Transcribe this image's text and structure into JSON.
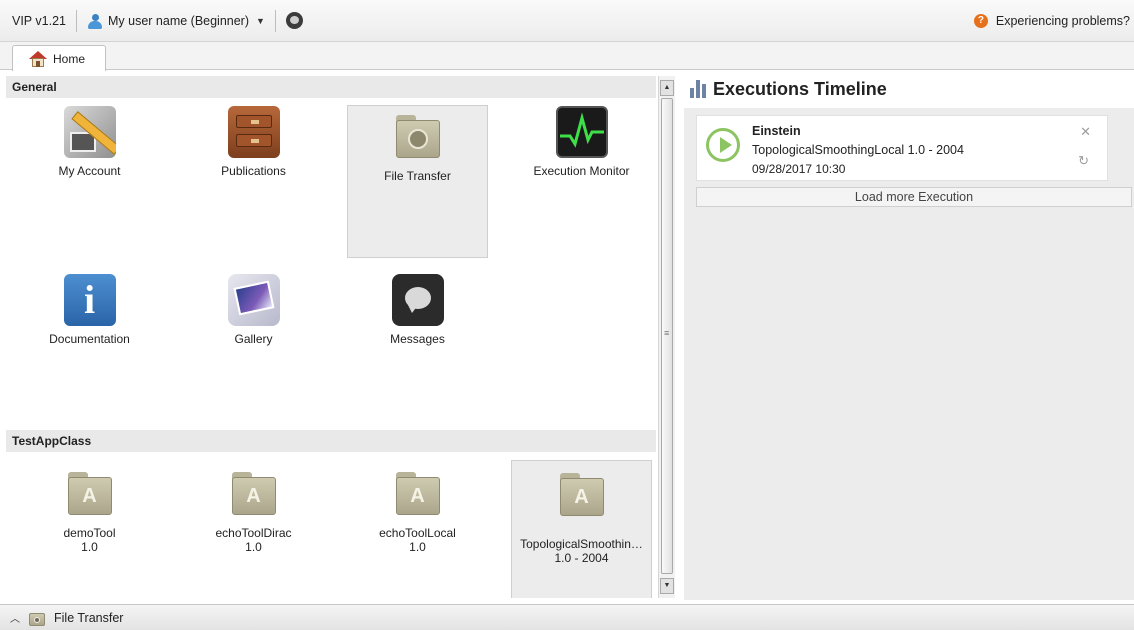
{
  "topbar": {
    "version": "VIP v1.21",
    "user_label": "My user name (Beginner)",
    "problems_label": "Experiencing problems?"
  },
  "tabs": [
    {
      "label": "Home",
      "icon": "home-icon",
      "active": true
    }
  ],
  "sections": [
    {
      "title": "General",
      "tiles": [
        {
          "label": "My Account",
          "icon": "my-account-icon"
        },
        {
          "label": "Publications",
          "icon": "publications-icon"
        },
        {
          "label": "File Transfer",
          "icon": "file-transfer-folder-icon",
          "selected": true
        },
        {
          "label": "Execution Monitor",
          "icon": "execution-monitor-icon"
        },
        {
          "label": "Documentation",
          "icon": "documentation-info-icon"
        },
        {
          "label": "Gallery",
          "icon": "gallery-icon"
        },
        {
          "label": "Messages",
          "icon": "messages-bubble-icon"
        }
      ]
    },
    {
      "title": "TestAppClass",
      "tiles": [
        {
          "label": "demoTool",
          "version": "1.0",
          "icon": "application-folder-icon"
        },
        {
          "label": "echoToolDirac",
          "version": "1.0",
          "icon": "application-folder-icon"
        },
        {
          "label": "echoToolLocal",
          "version": "1.0",
          "icon": "application-folder-icon"
        },
        {
          "label": "TopologicalSmoothin…",
          "version": "1.0 - 2004",
          "icon": "application-folder-icon",
          "selected": true
        }
      ]
    }
  ],
  "timeline": {
    "title": "Executions Timeline",
    "executions": [
      {
        "name": "Einstein",
        "application": "TopologicalSmoothingLocal 1.0 - 2004",
        "date": "09/28/2017 10:30",
        "status_icon": "running-play-icon"
      }
    ],
    "load_more_label": "Load more Execution"
  },
  "bottombar": {
    "label": "File Transfer"
  },
  "colors": {
    "running_green": "#8cc461",
    "header_gray": "#e9e9e9",
    "help_orange": "#e8701a"
  }
}
